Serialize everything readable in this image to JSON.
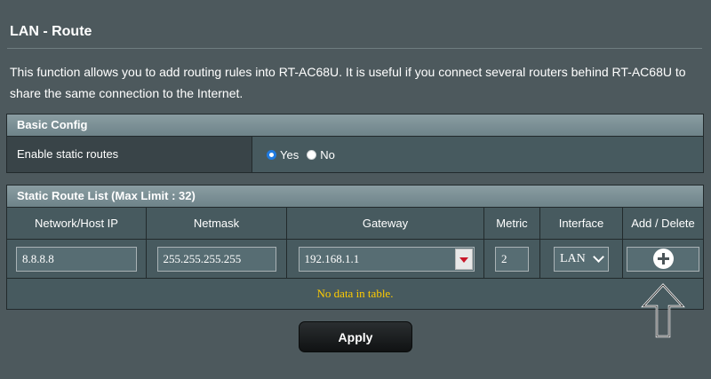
{
  "page": {
    "title": "LAN - Route",
    "description": "This function allows you to add routing rules into RT-AC68U. It is useful if you connect several routers behind RT-AC68U to share the same connection to the Internet."
  },
  "basic_config": {
    "header": "Basic Config",
    "label": "Enable static routes",
    "options": [
      "Yes",
      "No"
    ],
    "selected": "Yes"
  },
  "route_list": {
    "header": "Static Route List (Max Limit : 32)",
    "columns": [
      "Network/Host IP",
      "Netmask",
      "Gateway",
      "Metric",
      "Interface",
      "Add / Delete"
    ],
    "inputs": {
      "network_ip": "8.8.8.8",
      "netmask": "255.255.255.255",
      "gateway": "192.168.1.1",
      "metric": "2",
      "interface": "LAN"
    },
    "empty_message": "No data in table."
  },
  "actions": {
    "apply_label": "Apply"
  },
  "icons": {
    "add": "plus-circle-icon",
    "dropdown": "dropdown-arrow-icon",
    "annotation": "up-arrow-icon"
  },
  "colors": {
    "background": "#4d595d",
    "header": "#7a8f95",
    "empty_text": "#ffcc00",
    "radio_selected": "#1f7ae0"
  }
}
